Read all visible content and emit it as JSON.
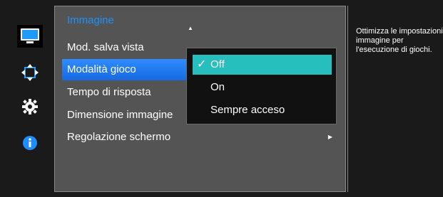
{
  "sidebar": {
    "icons": [
      "monitor-icon",
      "move-arrows-icon",
      "gear-icon",
      "info-icon"
    ]
  },
  "menu": {
    "header": "Immagine",
    "items": [
      "Mod. salva vista",
      "Modalità gioco",
      "Tempo di risposta",
      "Dimensione immagine",
      "Regolazione schermo"
    ],
    "selected_index": 1
  },
  "popup": {
    "options": [
      "Off",
      "On",
      "Sempre acceso"
    ],
    "selected": "Off"
  },
  "help": {
    "text": "Ottimizza le impostazioni immagine per l'esecuzione di giochi."
  },
  "colors": {
    "header": "#1e90ff",
    "menu_selection": "#2f8cff",
    "popup_selection": "#27bfbd"
  }
}
